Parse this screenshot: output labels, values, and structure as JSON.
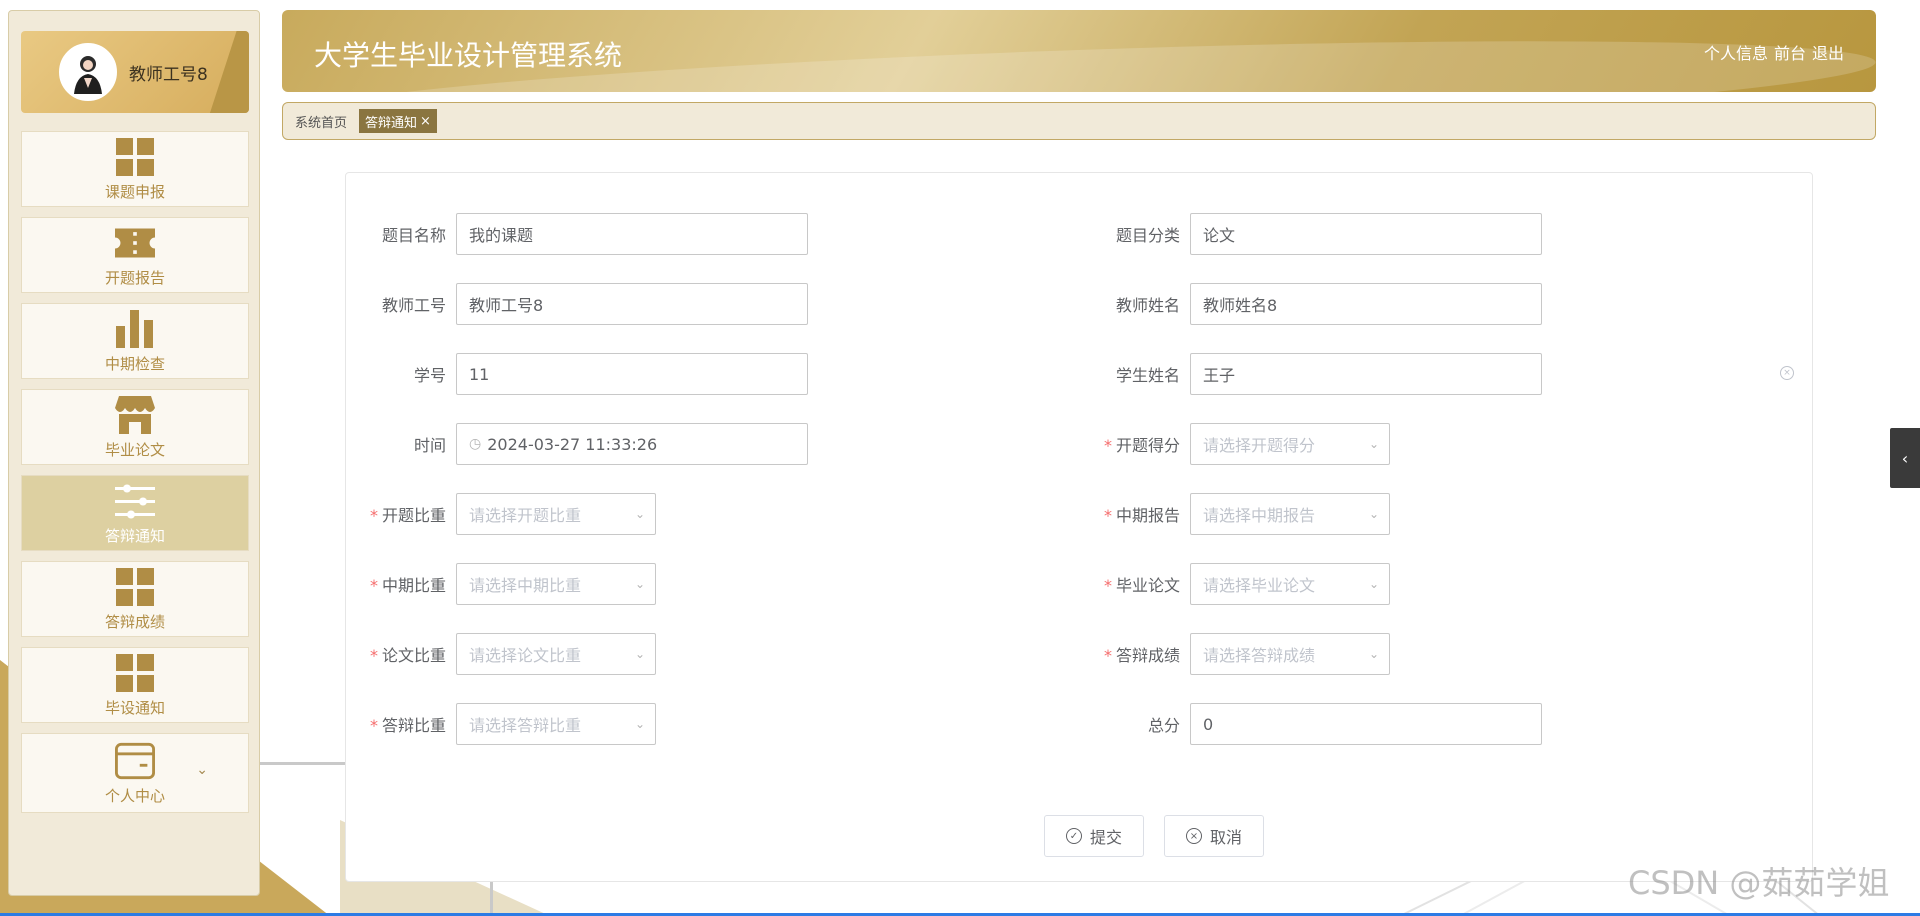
{
  "app": {
    "title": "大学生毕业设计管理系统"
  },
  "header": {
    "links": [
      "个人信息",
      "前台",
      "退出"
    ]
  },
  "profile": {
    "name": "教师工号8"
  },
  "sidebar": {
    "items": [
      {
        "label": "课题申报",
        "icon": "grid-icon",
        "active": false
      },
      {
        "label": "开题报告",
        "icon": "ticket-icon",
        "active": false
      },
      {
        "label": "中期检查",
        "icon": "bar-chart-icon",
        "active": false
      },
      {
        "label": "毕业论文",
        "icon": "store-icon",
        "active": false
      },
      {
        "label": "答辩通知",
        "icon": "sliders-icon",
        "active": true
      },
      {
        "label": "答辩成绩",
        "icon": "grid-icon",
        "active": false
      },
      {
        "label": "毕设通知",
        "icon": "grid-icon",
        "active": false
      },
      {
        "label": "个人中心",
        "icon": "wallet-icon",
        "active": false
      }
    ]
  },
  "breadcrumb": {
    "home": "系统首页",
    "tab": "答辩通知",
    "close": "×"
  },
  "form": {
    "topic_name": {
      "label": "题目名称",
      "value": "我的课题"
    },
    "topic_category": {
      "label": "题目分类",
      "value": "论文"
    },
    "teacher_id": {
      "label": "教师工号",
      "value": "教师工号8"
    },
    "teacher_name": {
      "label": "教师姓名",
      "value": "教师姓名8"
    },
    "student_id": {
      "label": "学号",
      "value": "11"
    },
    "student_name": {
      "label": "学生姓名",
      "value": "王子"
    },
    "time": {
      "label": "时间",
      "value": "2024-03-27 11:33:26"
    },
    "proposal_score": {
      "label": "开题得分",
      "placeholder": "请选择开题得分"
    },
    "proposal_weight": {
      "label": "开题比重",
      "placeholder": "请选择开题比重"
    },
    "midterm_report": {
      "label": "中期报告",
      "placeholder": "请选择中期报告"
    },
    "midterm_weight": {
      "label": "中期比重",
      "placeholder": "请选择中期比重"
    },
    "thesis": {
      "label": "毕业论文",
      "placeholder": "请选择毕业论文"
    },
    "thesis_weight": {
      "label": "论文比重",
      "placeholder": "请选择论文比重"
    },
    "defense_score": {
      "label": "答辩成绩",
      "placeholder": "请选择答辩成绩"
    },
    "defense_weight": {
      "label": "答辩比重",
      "placeholder": "请选择答辩比重"
    },
    "total": {
      "label": "总分",
      "value": "0"
    },
    "required_mark": "*"
  },
  "buttons": {
    "submit": "提交",
    "cancel": "取消"
  },
  "watermark": "CSDN @茹茹学姐",
  "colors": {
    "accent": "#c8aa5c",
    "sidebar_bg": "#f1ead9",
    "active_nav": "#ddd0a1",
    "nav_text": "#b08d45",
    "required": "#f56c6c"
  }
}
